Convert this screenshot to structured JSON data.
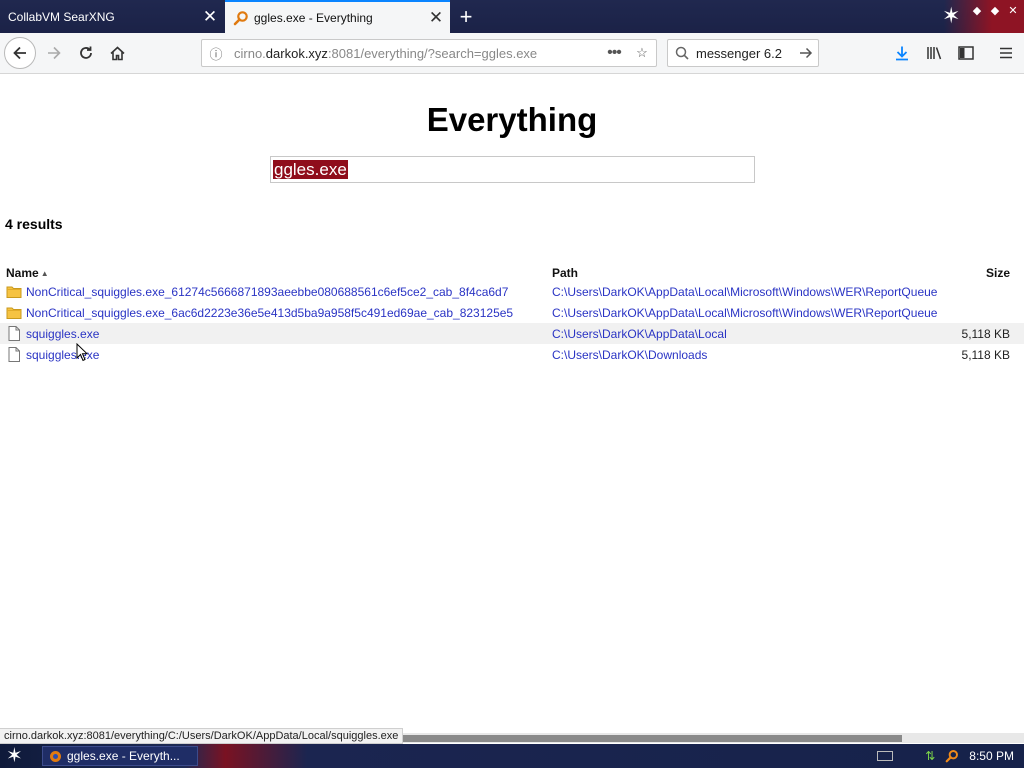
{
  "browser": {
    "tabs": [
      {
        "title": "CollabVM SearXNG",
        "active": false
      },
      {
        "title": "ggles.exe - Everything",
        "active": true
      }
    ],
    "url": {
      "prefix": "cirno.",
      "domain": "darkok.xyz",
      "suffix": ":8081/everything/?search=ggles.exe"
    },
    "search_box": "messenger 6.2",
    "accent_color": "#0a84ff"
  },
  "page": {
    "title": "Everything",
    "search_value": "ggles.exe",
    "result_count": "4 results",
    "columns": {
      "name": "Name",
      "path": "Path",
      "size": "Size"
    },
    "sort": {
      "column": "Name",
      "direction": "ascending"
    },
    "results": [
      {
        "type": "folder-icon",
        "name": "NonCritical_squiggles.exe_61274c5666871893aeebbe080688561c6ef5ce2_cab_8f4ca6d7",
        "path": "C:\\Users\\DarkOK\\AppData\\Local\\Microsoft\\Windows\\WER\\ReportQueue",
        "size": ""
      },
      {
        "type": "folder-icon",
        "name": "NonCritical_squiggles.exe_6ac6d2223e36e5e413d5ba9a958f5c491ed69ae_cab_823125e5",
        "path": "C:\\Users\\DarkOK\\AppData\\Local\\Microsoft\\Windows\\WER\\ReportQueue",
        "size": ""
      },
      {
        "type": "file-icon",
        "name": "squiggles.exe",
        "path": "C:\\Users\\DarkOK\\AppData\\Local",
        "size": "5,118 KB"
      },
      {
        "type": "file-icon",
        "name": "squiggles.exe",
        "path": "C:\\Users\\DarkOK\\Downloads",
        "size": "5,118 KB"
      }
    ],
    "link_color": "#2a34c4",
    "selection_color": "#8f0d1b"
  },
  "status_tip": "cirno.darkok.xyz:8081/everything/C:/Users/DarkOK/AppData/Local/squiggles.exe",
  "taskbar": {
    "task_label": "ggles.exe - Everyth...",
    "clock": "8:50 PM"
  }
}
